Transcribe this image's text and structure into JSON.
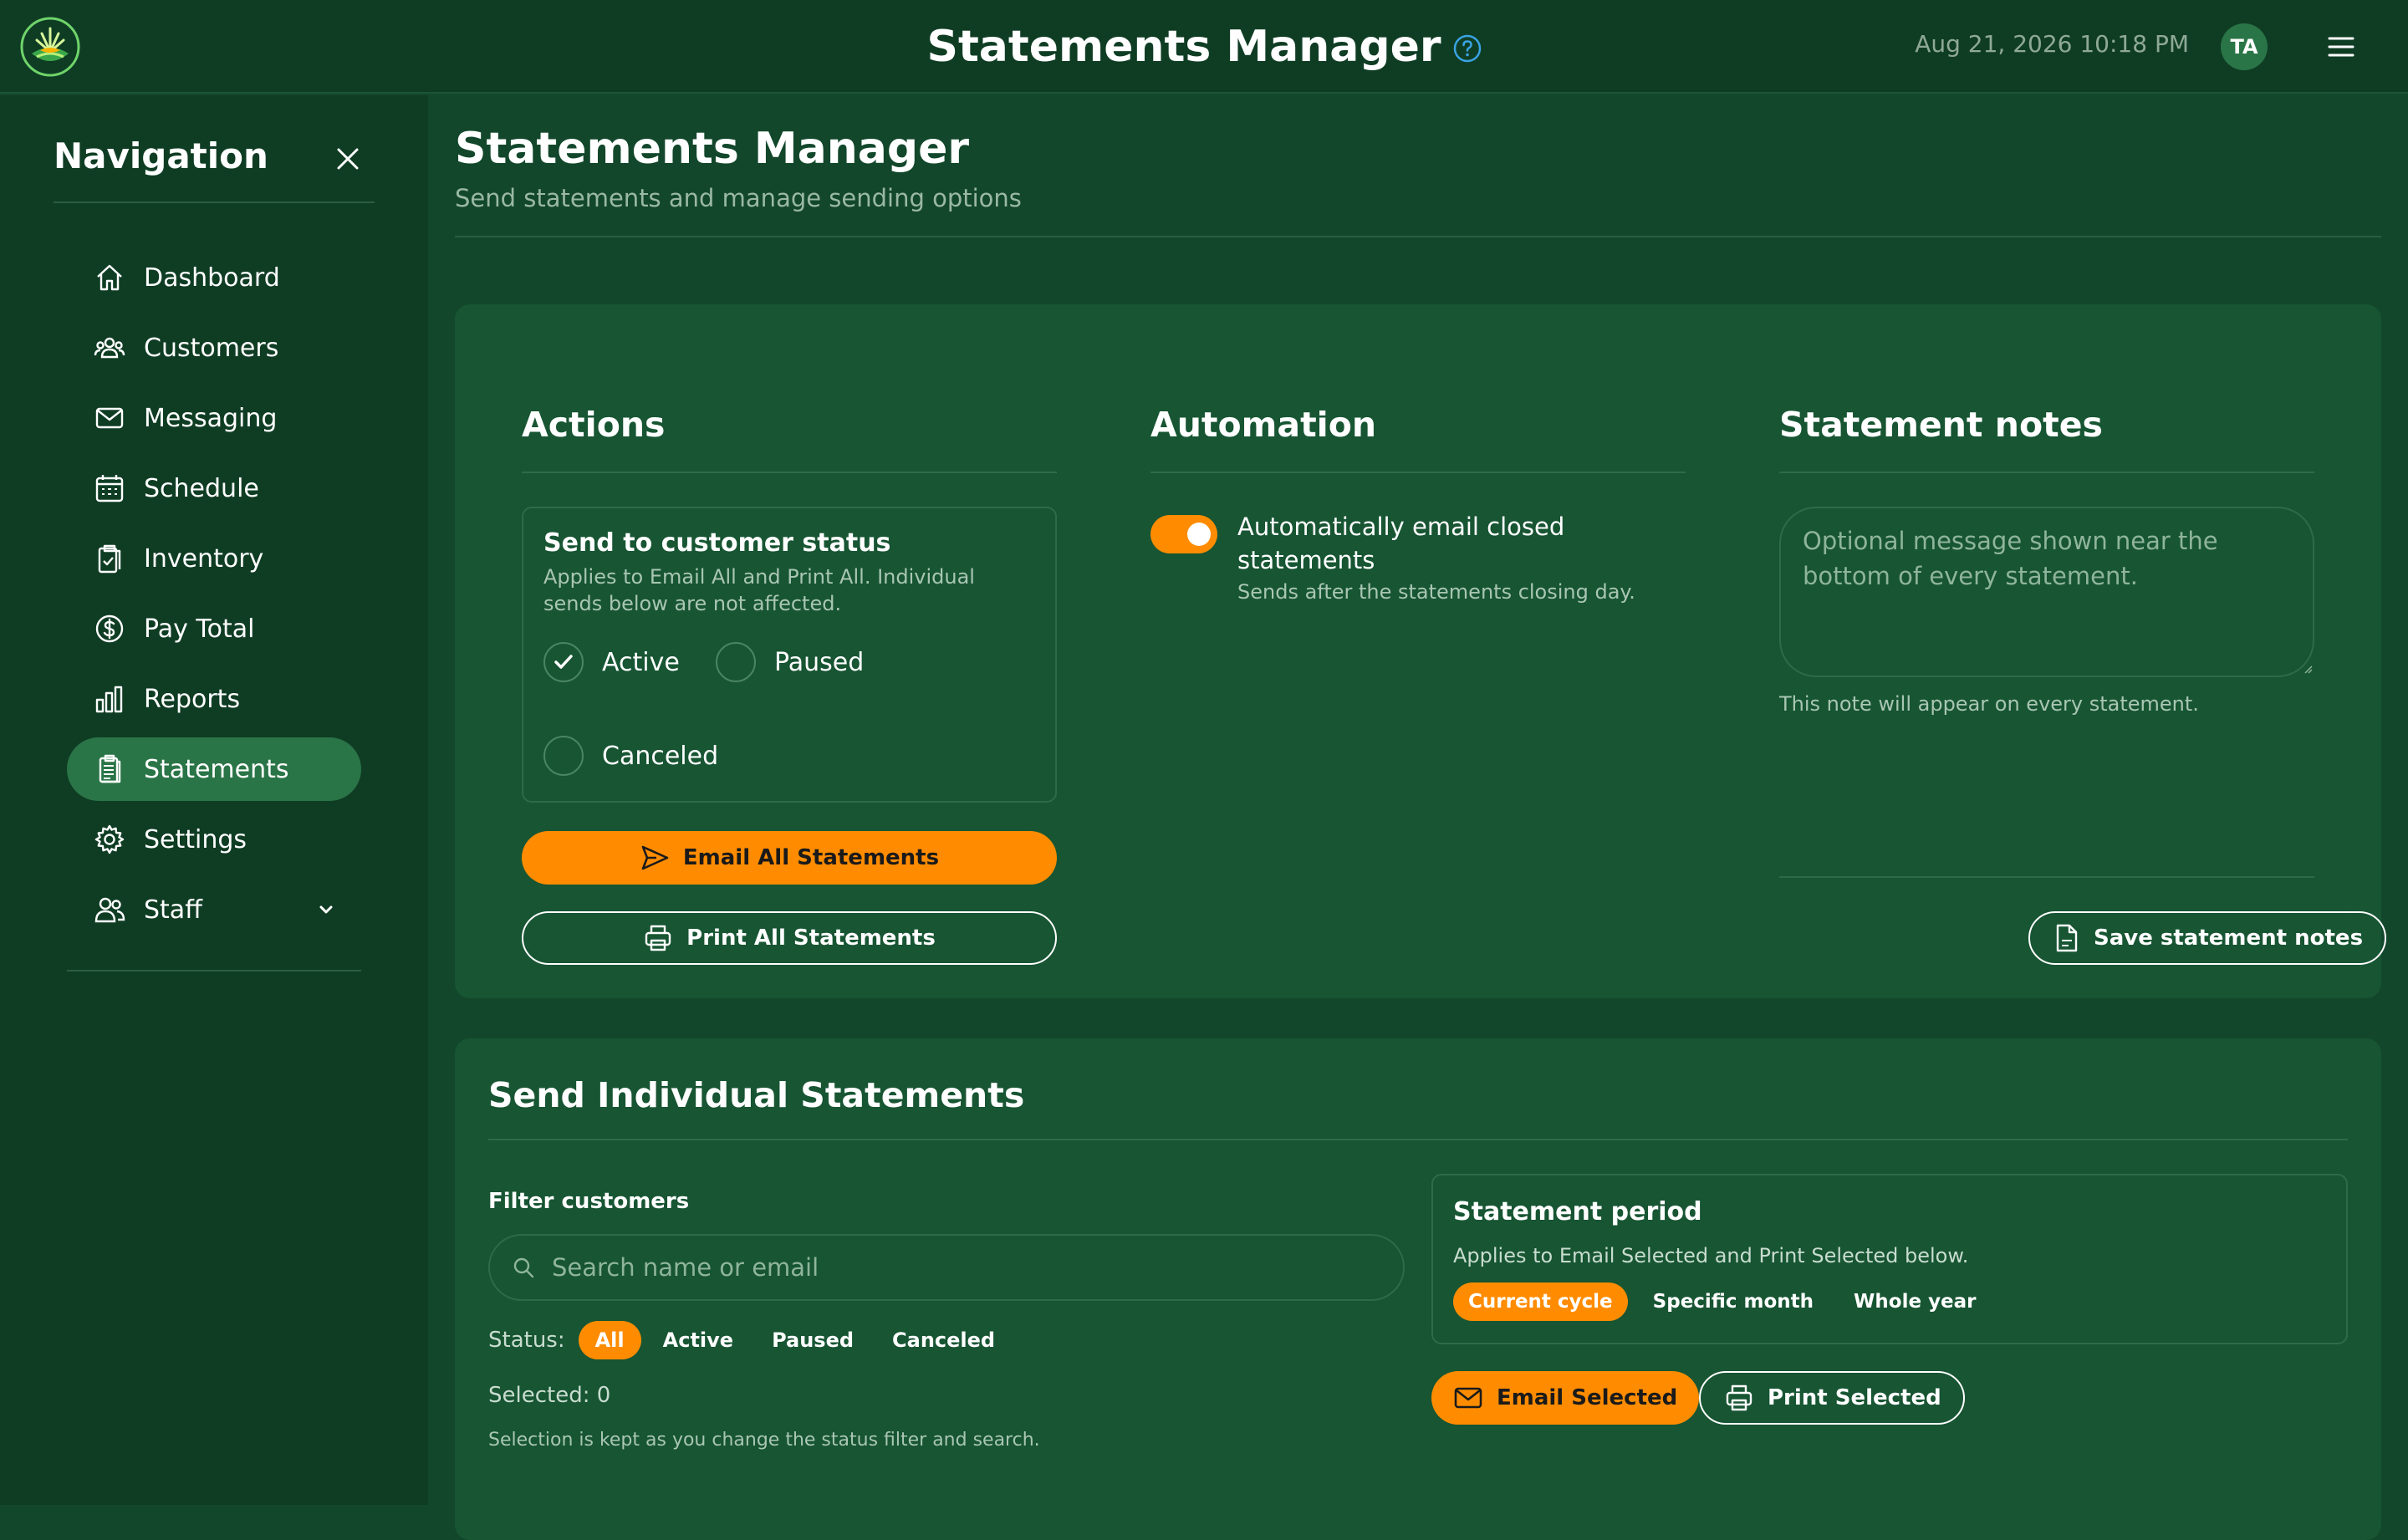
{
  "header": {
    "app_title": "Statements Manager",
    "datetime": "Aug 21, 2026 10:18 PM",
    "avatar_initials": "TA",
    "icons": [
      "logo",
      "help-icon",
      "menu-icon"
    ]
  },
  "sidebar": {
    "title": "Navigation",
    "items": [
      {
        "label": "Dashboard",
        "icon": "home-icon",
        "active": false
      },
      {
        "label": "Customers",
        "icon": "customers-icon",
        "active": false
      },
      {
        "label": "Messaging",
        "icon": "mail-icon",
        "active": false
      },
      {
        "label": "Schedule",
        "icon": "calendar-icon",
        "active": false
      },
      {
        "label": "Inventory",
        "icon": "clipboard-check-icon",
        "active": false
      },
      {
        "label": "Pay Total",
        "icon": "dollar-icon",
        "active": false
      },
      {
        "label": "Reports",
        "icon": "bar-chart-icon",
        "active": false
      },
      {
        "label": "Statements",
        "icon": "statements-icon",
        "active": true
      },
      {
        "label": "Settings",
        "icon": "gear-icon",
        "active": false
      },
      {
        "label": "Staff",
        "icon": "staff-icon",
        "active": false,
        "expandable": true
      }
    ]
  },
  "page": {
    "title": "Statements Manager",
    "subtitle": "Send statements and manage sending options"
  },
  "actions": {
    "heading": "Actions",
    "status_box": {
      "title": "Send to customer status",
      "description": "Applies to Email All and Print All. Individual sends below are not affected.",
      "options": [
        {
          "label": "Active",
          "checked": true
        },
        {
          "label": "Paused",
          "checked": false
        },
        {
          "label": "Canceled",
          "checked": false
        }
      ]
    },
    "email_all_label": "Email All Statements",
    "print_all_label": "Print All Statements"
  },
  "automation": {
    "heading": "Automation",
    "toggle_on": true,
    "toggle_label": "Automatically email closed statements",
    "toggle_sub": "Sends after the statements closing day."
  },
  "notes": {
    "heading": "Statement notes",
    "value": "",
    "placeholder": "Optional message shown near the bottom of every statement.",
    "help": "This note will appear on every statement.",
    "save_label": "Save statement notes"
  },
  "individual": {
    "heading": "Send Individual Statements",
    "filter_label": "Filter customers",
    "search_placeholder": "Search name or email",
    "status_label": "Status:",
    "status_chips": [
      {
        "label": "All",
        "selected": true
      },
      {
        "label": "Active",
        "selected": false
      },
      {
        "label": "Paused",
        "selected": false
      },
      {
        "label": "Canceled",
        "selected": false
      }
    ],
    "selected_text": "Selected: 0",
    "selection_note": "Selection is kept as you change the status filter and search.",
    "period": {
      "title": "Statement period",
      "description": "Applies to Email Selected and Print Selected below.",
      "options": [
        {
          "label": "Current cycle",
          "selected": true
        },
        {
          "label": "Specific month",
          "selected": false
        },
        {
          "label": "Whole year",
          "selected": false
        }
      ]
    },
    "email_selected_label": "Email Selected",
    "print_selected_label": "Print Selected"
  },
  "colors": {
    "background": "#12472b",
    "topbar": "#0f3d24",
    "panel": "#175533",
    "accent": "#ff8c00",
    "active_nav": "#2a7547",
    "info": "#3aa3e3"
  }
}
